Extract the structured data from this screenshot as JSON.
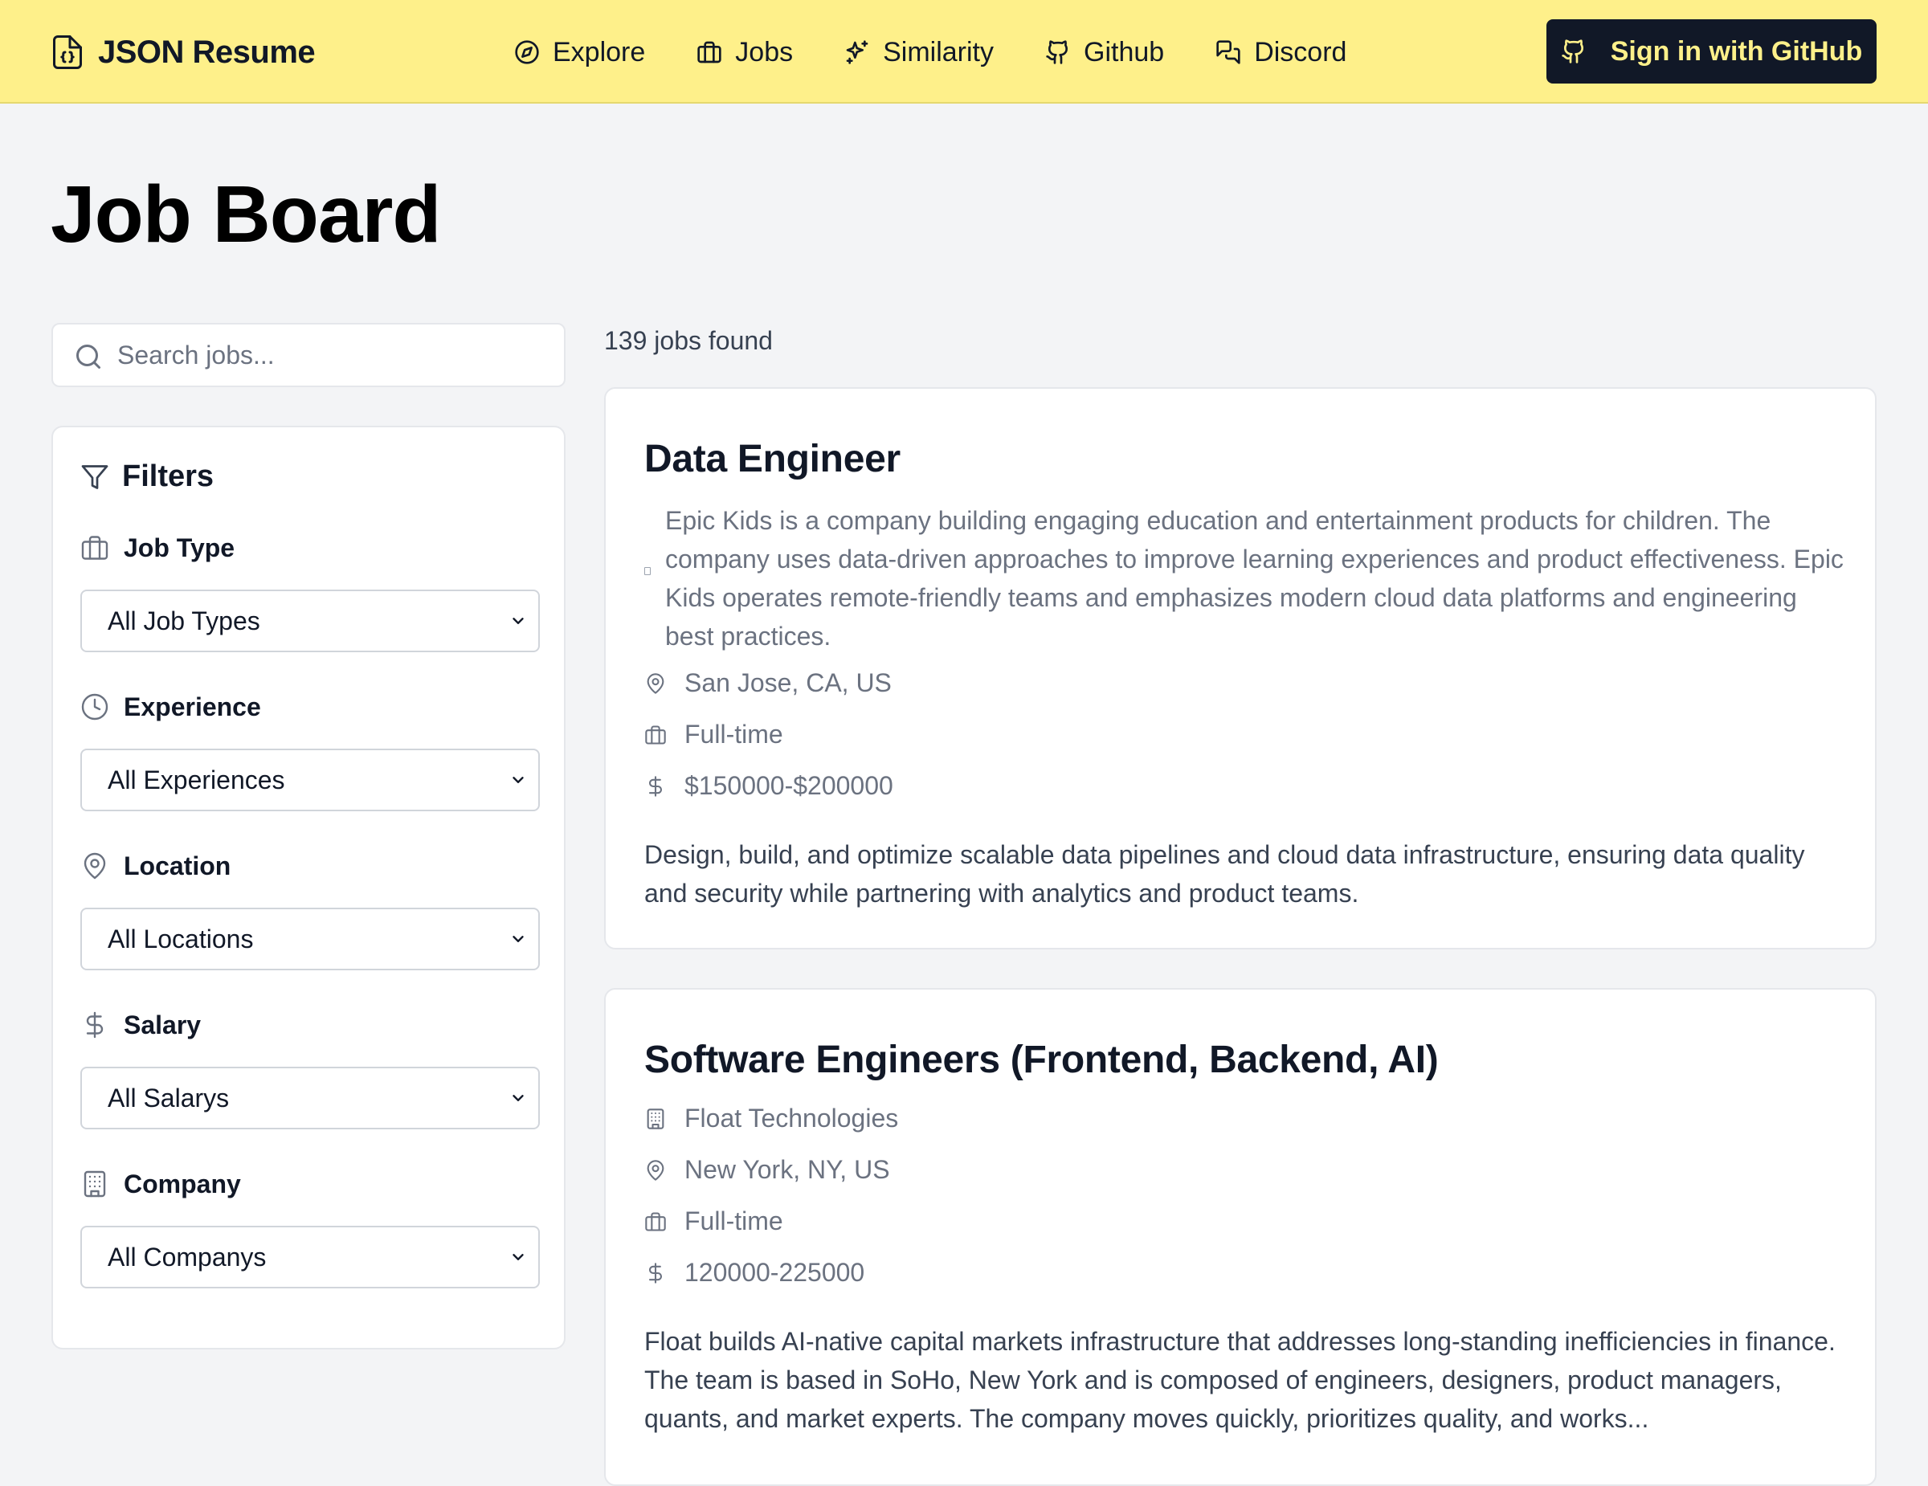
{
  "header": {
    "brand": "JSON Resume",
    "nav": [
      {
        "label": "Explore",
        "icon": "compass-icon"
      },
      {
        "label": "Jobs",
        "icon": "briefcase-icon"
      },
      {
        "label": "Similarity",
        "icon": "sparkles-icon"
      },
      {
        "label": "Github",
        "icon": "github-icon"
      },
      {
        "label": "Discord",
        "icon": "chat-bubbles-icon"
      }
    ],
    "signin_label": "Sign in with GitHub"
  },
  "page": {
    "title": "Job Board"
  },
  "search": {
    "placeholder": "Search jobs...",
    "value": ""
  },
  "filters": {
    "title": "Filters",
    "groups": [
      {
        "label": "Job Type",
        "icon": "briefcase-icon",
        "value": "All Job Types"
      },
      {
        "label": "Experience",
        "icon": "clock-icon",
        "value": "All Experiences"
      },
      {
        "label": "Location",
        "icon": "map-pin-icon",
        "value": "All Locations"
      },
      {
        "label": "Salary",
        "icon": "dollar-icon",
        "value": "All Salarys"
      },
      {
        "label": "Company",
        "icon": "building-icon",
        "value": "All Companys"
      }
    ]
  },
  "results": {
    "count": "139 jobs found",
    "jobs": [
      {
        "title": "Data Engineer",
        "company_description": "Epic Kids is a company building engaging education and entertainment products for children. The company uses data-driven approaches to improve learning experiences and product effectiveness. Epic Kids operates remote-friendly teams and emphasizes modern cloud data platforms and engineering best practices.",
        "location": "San Jose, CA, US",
        "type": "Full-time",
        "salary": "$150000-$200000",
        "description": "Design, build, and optimize scalable data pipelines and cloud data infrastructure, ensuring data quality and security while partnering with analytics and product teams."
      },
      {
        "title": "Software Engineers (Frontend, Backend, AI)",
        "company": "Float Technologies",
        "location": "New York, NY, US",
        "type": "Full-time",
        "salary": "120000-225000",
        "description": "Float builds AI-native capital markets infrastructure that addresses long-standing inefficiencies in finance. The team is based in SoHo, New York and is composed of engineers, designers, product managers, quants, and market experts. The company moves quickly, prioritizes quality, and works..."
      }
    ]
  },
  "colors": {
    "header_bg": "#fef08a",
    "signin_bg": "#111827",
    "signin_text": "#fef08a",
    "page_bg": "#f3f4f6"
  }
}
